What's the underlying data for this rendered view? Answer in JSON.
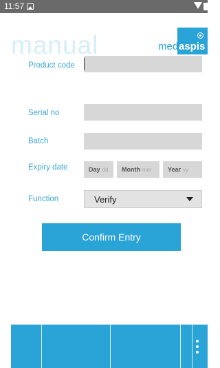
{
  "status_bar": {
    "time": "11:57",
    "icons": [
      "image-icon",
      "wifi-icon",
      "battery-icon"
    ]
  },
  "header": {
    "title": "manual",
    "logo": {
      "med": "med",
      "aspis": "aspis"
    }
  },
  "form": {
    "product_code": {
      "label": "Product code",
      "value": ""
    },
    "serial_no": {
      "label": "Serial no",
      "value": ""
    },
    "batch": {
      "label": "Batch",
      "value": ""
    },
    "expiry_date": {
      "label": "Expiry date",
      "day": {
        "label": "Day",
        "placeholder": "dd"
      },
      "month": {
        "label": "Month",
        "placeholder": "mm"
      },
      "year": {
        "label": "Year",
        "placeholder": "yy"
      }
    },
    "function": {
      "label": "Function",
      "selected": "Verify"
    }
  },
  "confirm_button": {
    "label": "Confirm Entry"
  },
  "bottom_nav": {
    "more_icon": "more-vertical-icon"
  },
  "colors": {
    "accent": "#2aa3d6",
    "title_light": "#d6eef8",
    "field_bg": "#d7d7d7",
    "status_bar": "#6a6a6a"
  }
}
